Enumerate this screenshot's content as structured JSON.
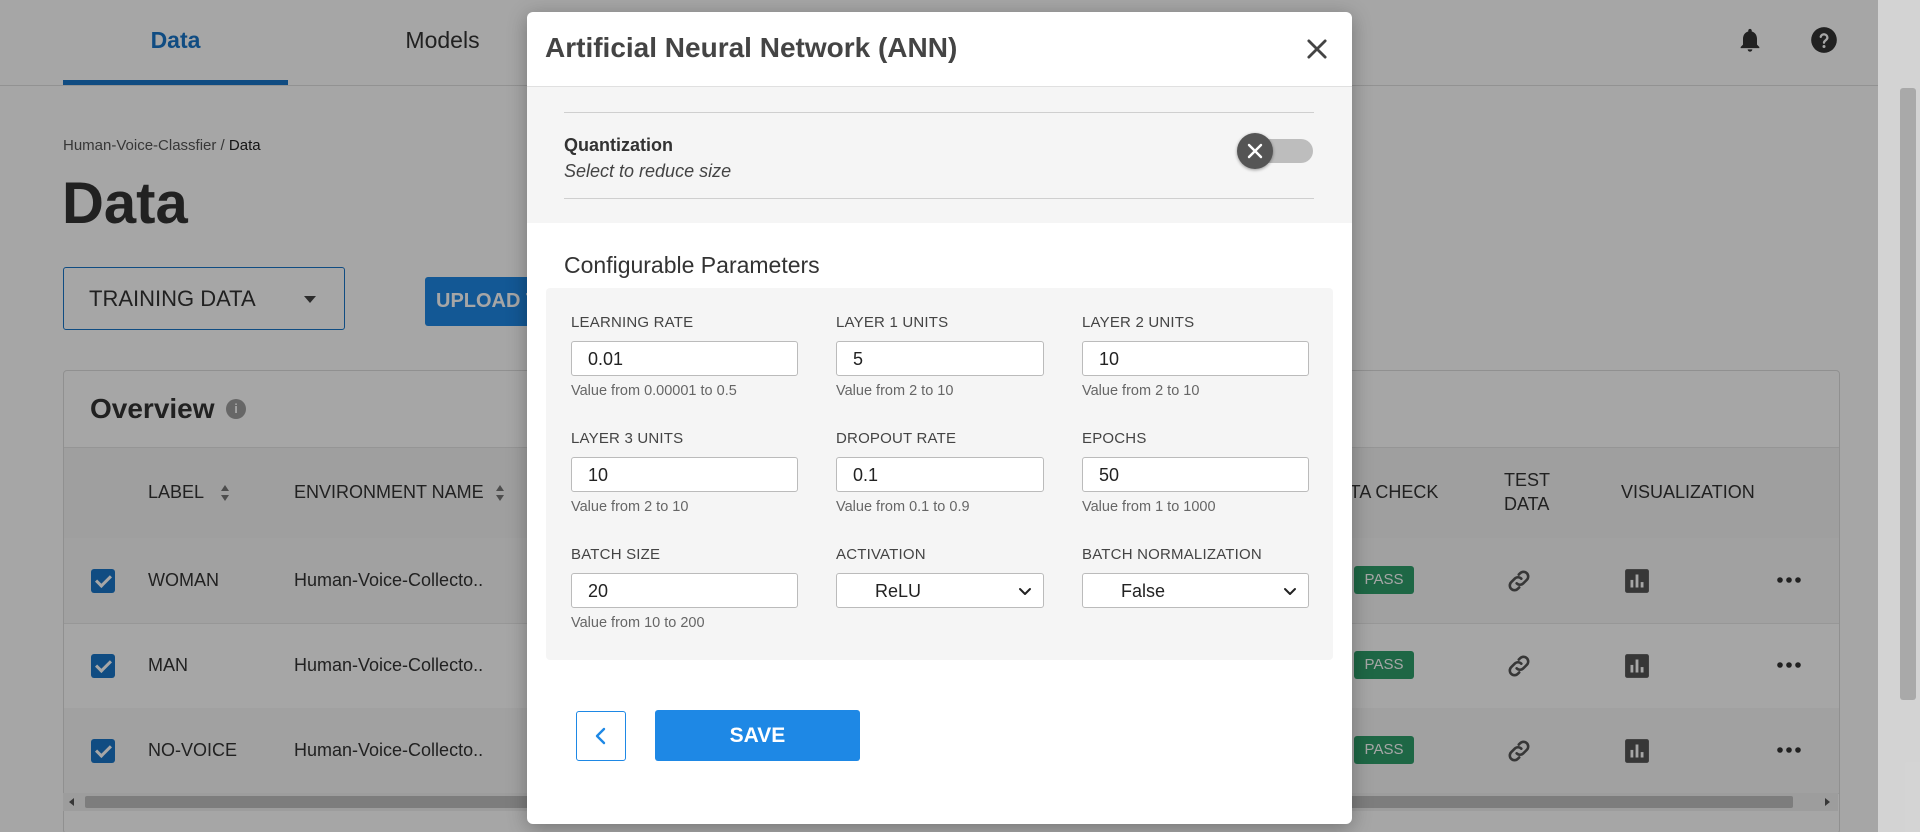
{
  "nav": {
    "tabs": [
      {
        "label": "Data",
        "active": true
      },
      {
        "label": "Models",
        "active": false
      }
    ]
  },
  "breadcrumb": {
    "parent": "Human-Voice-Classfier",
    "separator": " / ",
    "current": "Data"
  },
  "page": {
    "title": "Data",
    "dataset_dropdown": "TRAINING DATA",
    "upload_button": "UPLOAD T"
  },
  "overview": {
    "title": "Overview",
    "info_glyph": "i",
    "columns": {
      "label": "LABEL",
      "environment": "ENVIRONMENT NAME",
      "data_check": "ATA CHECK",
      "test_data_1": "TEST",
      "test_data_2": "DATA",
      "visualization": "VISUALIZATION"
    },
    "rows": [
      {
        "label": "WOMAN",
        "environment": "Human-Voice-Collecto..",
        "check": "PASS"
      },
      {
        "label": "MAN",
        "environment": "Human-Voice-Collecto..",
        "check": "PASS"
      },
      {
        "label": "NO-VOICE",
        "environment": "Human-Voice-Collecto..",
        "check": "PASS"
      }
    ]
  },
  "modal": {
    "title": "Artificial Neural Network (ANN)",
    "quantization": {
      "label": "Quantization",
      "sublabel": "Select to reduce size",
      "enabled": false
    },
    "section_title": "Configurable Parameters",
    "params": {
      "learning_rate": {
        "label": "LEARNING RATE",
        "value": "0.01",
        "help": "Value from 0.00001 to 0.5"
      },
      "layer1": {
        "label": "LAYER 1 UNITS",
        "value": "5",
        "help": "Value from 2 to 10"
      },
      "layer2": {
        "label": "LAYER 2 UNITS",
        "value": "10",
        "help": "Value from 2 to 10"
      },
      "layer3": {
        "label": "LAYER 3 UNITS",
        "value": "10",
        "help": "Value from 2 to 10"
      },
      "dropout": {
        "label": "DROPOUT RATE",
        "value": "0.1",
        "help": "Value from 0.1 to 0.9"
      },
      "epochs": {
        "label": "EPOCHS",
        "value": "50",
        "help": "Value from 1 to 1000"
      },
      "batch_size": {
        "label": "BATCH SIZE",
        "value": "20",
        "help": "Value from 10 to 200"
      },
      "activation": {
        "label": "ACTIVATION",
        "value": "ReLU"
      },
      "batch_norm": {
        "label": "BATCH NORMALIZATION",
        "value": "False"
      }
    },
    "save_button": "SAVE"
  },
  "colors": {
    "accent": "#1e88e5",
    "tab_active": "#1976c8",
    "pass_badge": "#2e9e6a",
    "overlay": "rgba(0,0,0,0.35)"
  },
  "icons": [
    "bell-icon",
    "help-icon",
    "sort-icon",
    "info-icon",
    "link-icon",
    "bar-chart-icon",
    "more-icon",
    "close-icon",
    "chevron-down-icon",
    "chevron-left-icon"
  ]
}
